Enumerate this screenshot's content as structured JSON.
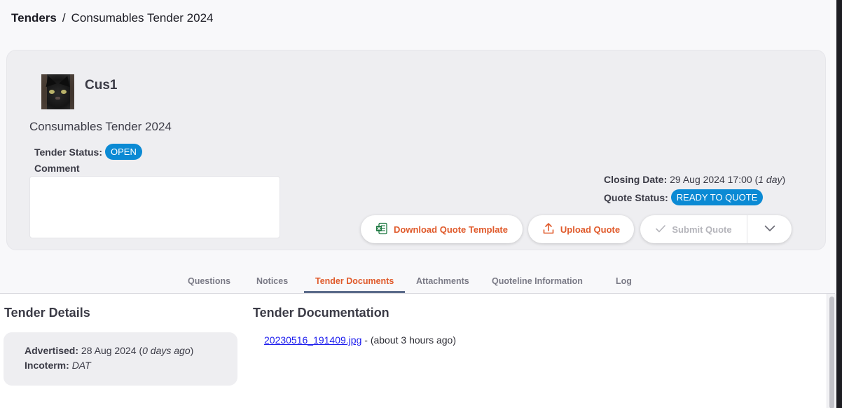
{
  "breadcrumb": {
    "root": "Tenders",
    "separator": "/",
    "current": "Consumables Tender 2024"
  },
  "header": {
    "company_name": "Cus1",
    "tender_name": "Consumables Tender 2024",
    "tender_status_label": "Tender Status:",
    "tender_status": "OPEN",
    "comment_label": "Comment",
    "comment_value": "",
    "closing_label": "Closing Date:",
    "closing_date": "29 Aug 2024 17:00 (",
    "closing_relative": "1 day",
    "closing_suffix": ")",
    "quote_status_label": "Quote Status:",
    "quote_status": "READY TO QUOTE",
    "status_color": "#0b8ad4"
  },
  "actions": {
    "download_label": "Download Quote Template",
    "download_icon": "excel-file-icon",
    "upload_label": "Upload Quote",
    "upload_icon": "upload-icon",
    "submit_label": "Submit Quote",
    "submit_icon": "checkmark-icon",
    "more_icon": "chevron-down-icon",
    "accent_color": "#e05a2b"
  },
  "tabs": [
    {
      "label": "Questions"
    },
    {
      "label": "Notices"
    },
    {
      "label": "Tender Documents",
      "active": true
    },
    {
      "label": "Attachments"
    },
    {
      "label": "Quoteline Information"
    },
    {
      "label": "Log"
    }
  ],
  "details": {
    "title": "Tender Details",
    "advertised_label": "Advertised:",
    "advertised_date": "28 Aug 2024 (",
    "advertised_relative": "0 days ago",
    "advertised_suffix": ")",
    "incoterm_label": "Incoterm:",
    "incoterm_value": "DAT"
  },
  "documentation": {
    "title": "Tender Documentation",
    "files": [
      {
        "name": "20230516_191409.jpg",
        "meta": " - (about 3 hours ago)"
      }
    ]
  }
}
